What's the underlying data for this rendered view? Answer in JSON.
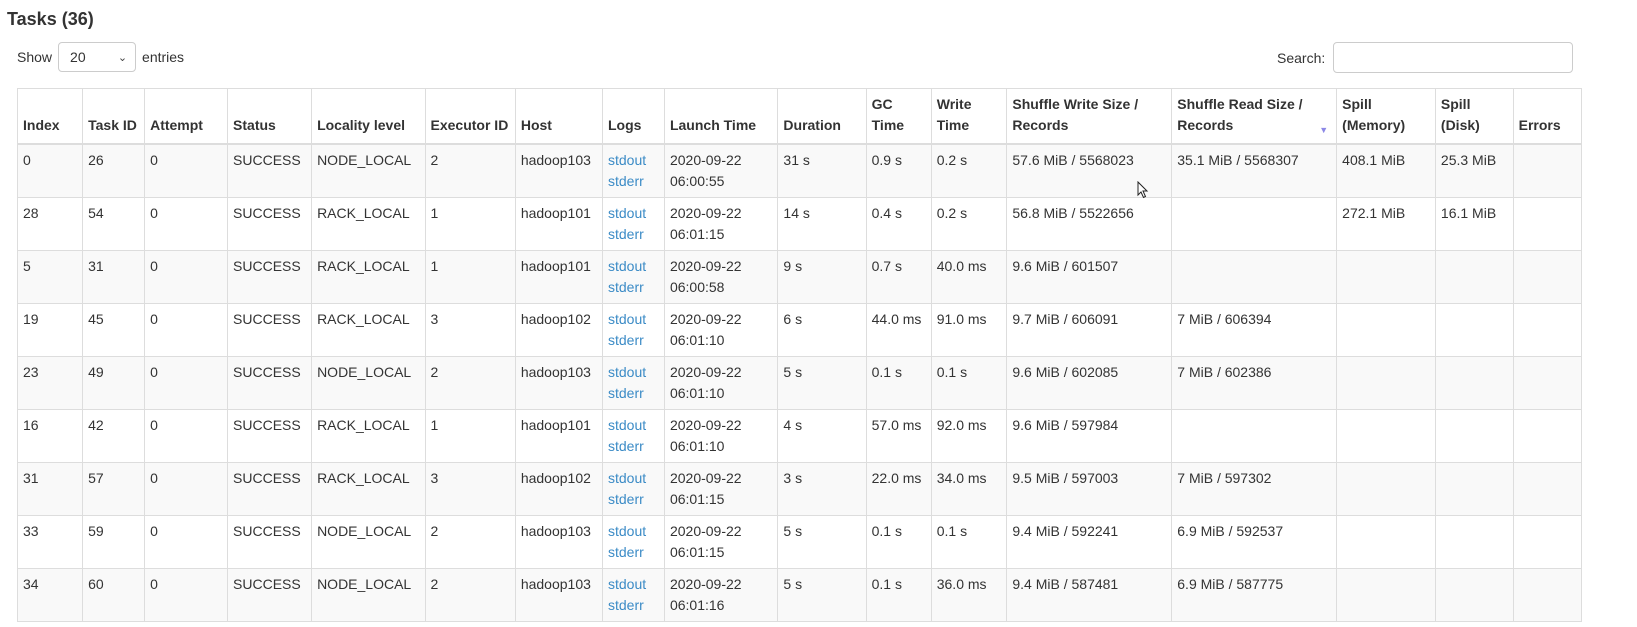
{
  "header": {
    "title": "Tasks (36)"
  },
  "controls": {
    "show_label": "Show",
    "entries_value": "20",
    "entries_label": "entries",
    "search_label": "Search:",
    "search_value": ""
  },
  "table": {
    "columns": [
      "Index",
      "Task ID",
      "Attempt",
      "Status",
      "Locality level",
      "Executor ID",
      "Host",
      "Logs",
      "Launch Time",
      "Duration",
      "GC Time",
      "Write Time",
      "Shuffle Write Size / Records",
      "Shuffle Read Size / Records",
      "Spill (Memory)",
      "Spill (Disk)",
      "Errors"
    ],
    "sorted_column": "Shuffle Read Size / Records",
    "sort_direction": "descending",
    "rows": [
      {
        "index": "0",
        "task_id": "26",
        "attempt": "0",
        "status": "SUCCESS",
        "locality": "NODE_LOCAL",
        "executor": "2",
        "host": "hadoop103",
        "log_out": "stdout",
        "log_err": "stderr",
        "launch_date": "2020-09-22",
        "launch_time": "06:00:55",
        "duration": "31 s",
        "gc": "0.9 s",
        "write": "0.2 s",
        "shuffle_write": "57.6 MiB / 5568023",
        "shuffle_read": "35.1 MiB / 5568307",
        "spill_mem": "408.1 MiB",
        "spill_disk": "25.3 MiB",
        "errors": ""
      },
      {
        "index": "28",
        "task_id": "54",
        "attempt": "0",
        "status": "SUCCESS",
        "locality": "RACK_LOCAL",
        "executor": "1",
        "host": "hadoop101",
        "log_out": "stdout",
        "log_err": "stderr",
        "launch_date": "2020-09-22",
        "launch_time": "06:01:15",
        "duration": "14 s",
        "gc": "0.4 s",
        "write": "0.2 s",
        "shuffle_write": "56.8 MiB / 5522656",
        "shuffle_read": "",
        "spill_mem": "272.1 MiB",
        "spill_disk": "16.1 MiB",
        "errors": ""
      },
      {
        "index": "5",
        "task_id": "31",
        "attempt": "0",
        "status": "SUCCESS",
        "locality": "RACK_LOCAL",
        "executor": "1",
        "host": "hadoop101",
        "log_out": "stdout",
        "log_err": "stderr",
        "launch_date": "2020-09-22",
        "launch_time": "06:00:58",
        "duration": "9 s",
        "gc": "0.7 s",
        "write": "40.0 ms",
        "shuffle_write": "9.6 MiB / 601507",
        "shuffle_read": "",
        "spill_mem": "",
        "spill_disk": "",
        "errors": ""
      },
      {
        "index": "19",
        "task_id": "45",
        "attempt": "0",
        "status": "SUCCESS",
        "locality": "RACK_LOCAL",
        "executor": "3",
        "host": "hadoop102",
        "log_out": "stdout",
        "log_err": "stderr",
        "launch_date": "2020-09-22",
        "launch_time": "06:01:10",
        "duration": "6 s",
        "gc": "44.0 ms",
        "write": "91.0 ms",
        "shuffle_write": "9.7 MiB / 606091",
        "shuffle_read": "7 MiB / 606394",
        "spill_mem": "",
        "spill_disk": "",
        "errors": ""
      },
      {
        "index": "23",
        "task_id": "49",
        "attempt": "0",
        "status": "SUCCESS",
        "locality": "NODE_LOCAL",
        "executor": "2",
        "host": "hadoop103",
        "log_out": "stdout",
        "log_err": "stderr",
        "launch_date": "2020-09-22",
        "launch_time": "06:01:10",
        "duration": "5 s",
        "gc": "0.1 s",
        "write": "0.1 s",
        "shuffle_write": "9.6 MiB / 602085",
        "shuffle_read": "7 MiB / 602386",
        "spill_mem": "",
        "spill_disk": "",
        "errors": ""
      },
      {
        "index": "16",
        "task_id": "42",
        "attempt": "0",
        "status": "SUCCESS",
        "locality": "RACK_LOCAL",
        "executor": "1",
        "host": "hadoop101",
        "log_out": "stdout",
        "log_err": "stderr",
        "launch_date": "2020-09-22",
        "launch_time": "06:01:10",
        "duration": "4 s",
        "gc": "57.0 ms",
        "write": "92.0 ms",
        "shuffle_write": "9.6 MiB / 597984",
        "shuffle_read": "",
        "spill_mem": "",
        "spill_disk": "",
        "errors": ""
      },
      {
        "index": "31",
        "task_id": "57",
        "attempt": "0",
        "status": "SUCCESS",
        "locality": "RACK_LOCAL",
        "executor": "3",
        "host": "hadoop102",
        "log_out": "stdout",
        "log_err": "stderr",
        "launch_date": "2020-09-22",
        "launch_time": "06:01:15",
        "duration": "3 s",
        "gc": "22.0 ms",
        "write": "34.0 ms",
        "shuffle_write": "9.5 MiB / 597003",
        "shuffle_read": "7 MiB / 597302",
        "spill_mem": "",
        "spill_disk": "",
        "errors": ""
      },
      {
        "index": "33",
        "task_id": "59",
        "attempt": "0",
        "status": "SUCCESS",
        "locality": "NODE_LOCAL",
        "executor": "2",
        "host": "hadoop103",
        "log_out": "stdout",
        "log_err": "stderr",
        "launch_date": "2020-09-22",
        "launch_time": "06:01:15",
        "duration": "5 s",
        "gc": "0.1 s",
        "write": "0.1 s",
        "shuffle_write": "9.4 MiB / 592241",
        "shuffle_read": "6.9 MiB / 592537",
        "spill_mem": "",
        "spill_disk": "",
        "errors": ""
      },
      {
        "index": "34",
        "task_id": "60",
        "attempt": "0",
        "status": "SUCCESS",
        "locality": "NODE_LOCAL",
        "executor": "2",
        "host": "hadoop103",
        "log_out": "stdout",
        "log_err": "stderr",
        "launch_date": "2020-09-22",
        "launch_time": "06:01:16",
        "duration": "5 s",
        "gc": "0.1 s",
        "write": "36.0 ms",
        "shuffle_write": "9.4 MiB / 587481",
        "shuffle_read": "6.9 MiB / 587775",
        "spill_mem": "",
        "spill_disk": "",
        "errors": ""
      }
    ]
  },
  "colors": {
    "link": "#3b8bc6",
    "sort_arrow": "#8c88e6",
    "stripe": "#f9f9f9"
  }
}
